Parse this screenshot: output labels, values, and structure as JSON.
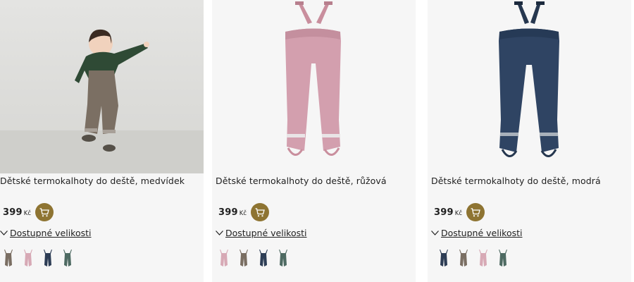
{
  "products": [
    {
      "title": "Dětské termokalhoty do deště, medvídek",
      "price": "399",
      "currency": "Kč",
      "sizes_label": "Dostupné velikosti",
      "swatch_colors": [
        "#7a6e62",
        "#d7a9b5",
        "#2d3d55",
        "#4e6a62"
      ],
      "selected_swatch": 0
    },
    {
      "title": "Dětské termokalhoty do deště, růžová",
      "price": "399",
      "currency": "Kč",
      "sizes_label": "Dostupné velikosti",
      "swatch_colors": [
        "#d7a9b5",
        "#7a6e62",
        "#2d3d55",
        "#4e6a62"
      ],
      "selected_swatch": 0
    },
    {
      "title": "Dětské termokalhoty do deště, modrá",
      "price": "399",
      "currency": "Kč",
      "sizes_label": "Dostupné velikosti",
      "swatch_colors": [
        "#2d3d55",
        "#7a6e62",
        "#d7a9b5",
        "#4e6a62"
      ],
      "selected_swatch": 0
    }
  ],
  "colors": {
    "cart_button": "#8e7432",
    "card_bg": "#f6f6f6",
    "pink_pants": "#d39fae",
    "navy_pants": "#2f4463",
    "brown_pants": "#7b6f63"
  },
  "icons": {
    "cart": "cart-icon",
    "chevron": "chevron-down-icon"
  }
}
